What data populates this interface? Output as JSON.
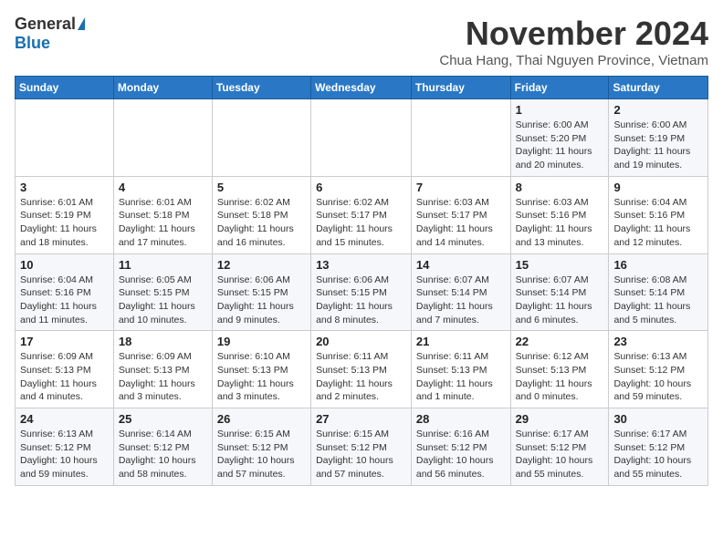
{
  "logo": {
    "general": "General",
    "blue": "Blue"
  },
  "title": "November 2024",
  "location": "Chua Hang, Thai Nguyen Province, Vietnam",
  "headers": [
    "Sunday",
    "Monday",
    "Tuesday",
    "Wednesday",
    "Thursday",
    "Friday",
    "Saturday"
  ],
  "weeks": [
    [
      {
        "day": "",
        "info": ""
      },
      {
        "day": "",
        "info": ""
      },
      {
        "day": "",
        "info": ""
      },
      {
        "day": "",
        "info": ""
      },
      {
        "day": "",
        "info": ""
      },
      {
        "day": "1",
        "info": "Sunrise: 6:00 AM\nSunset: 5:20 PM\nDaylight: 11 hours and 20 minutes."
      },
      {
        "day": "2",
        "info": "Sunrise: 6:00 AM\nSunset: 5:19 PM\nDaylight: 11 hours and 19 minutes."
      }
    ],
    [
      {
        "day": "3",
        "info": "Sunrise: 6:01 AM\nSunset: 5:19 PM\nDaylight: 11 hours and 18 minutes."
      },
      {
        "day": "4",
        "info": "Sunrise: 6:01 AM\nSunset: 5:18 PM\nDaylight: 11 hours and 17 minutes."
      },
      {
        "day": "5",
        "info": "Sunrise: 6:02 AM\nSunset: 5:18 PM\nDaylight: 11 hours and 16 minutes."
      },
      {
        "day": "6",
        "info": "Sunrise: 6:02 AM\nSunset: 5:17 PM\nDaylight: 11 hours and 15 minutes."
      },
      {
        "day": "7",
        "info": "Sunrise: 6:03 AM\nSunset: 5:17 PM\nDaylight: 11 hours and 14 minutes."
      },
      {
        "day": "8",
        "info": "Sunrise: 6:03 AM\nSunset: 5:16 PM\nDaylight: 11 hours and 13 minutes."
      },
      {
        "day": "9",
        "info": "Sunrise: 6:04 AM\nSunset: 5:16 PM\nDaylight: 11 hours and 12 minutes."
      }
    ],
    [
      {
        "day": "10",
        "info": "Sunrise: 6:04 AM\nSunset: 5:16 PM\nDaylight: 11 hours and 11 minutes."
      },
      {
        "day": "11",
        "info": "Sunrise: 6:05 AM\nSunset: 5:15 PM\nDaylight: 11 hours and 10 minutes."
      },
      {
        "day": "12",
        "info": "Sunrise: 6:06 AM\nSunset: 5:15 PM\nDaylight: 11 hours and 9 minutes."
      },
      {
        "day": "13",
        "info": "Sunrise: 6:06 AM\nSunset: 5:15 PM\nDaylight: 11 hours and 8 minutes."
      },
      {
        "day": "14",
        "info": "Sunrise: 6:07 AM\nSunset: 5:14 PM\nDaylight: 11 hours and 7 minutes."
      },
      {
        "day": "15",
        "info": "Sunrise: 6:07 AM\nSunset: 5:14 PM\nDaylight: 11 hours and 6 minutes."
      },
      {
        "day": "16",
        "info": "Sunrise: 6:08 AM\nSunset: 5:14 PM\nDaylight: 11 hours and 5 minutes."
      }
    ],
    [
      {
        "day": "17",
        "info": "Sunrise: 6:09 AM\nSunset: 5:13 PM\nDaylight: 11 hours and 4 minutes."
      },
      {
        "day": "18",
        "info": "Sunrise: 6:09 AM\nSunset: 5:13 PM\nDaylight: 11 hours and 3 minutes."
      },
      {
        "day": "19",
        "info": "Sunrise: 6:10 AM\nSunset: 5:13 PM\nDaylight: 11 hours and 3 minutes."
      },
      {
        "day": "20",
        "info": "Sunrise: 6:11 AM\nSunset: 5:13 PM\nDaylight: 11 hours and 2 minutes."
      },
      {
        "day": "21",
        "info": "Sunrise: 6:11 AM\nSunset: 5:13 PM\nDaylight: 11 hours and 1 minute."
      },
      {
        "day": "22",
        "info": "Sunrise: 6:12 AM\nSunset: 5:13 PM\nDaylight: 11 hours and 0 minutes."
      },
      {
        "day": "23",
        "info": "Sunrise: 6:13 AM\nSunset: 5:12 PM\nDaylight: 10 hours and 59 minutes."
      }
    ],
    [
      {
        "day": "24",
        "info": "Sunrise: 6:13 AM\nSunset: 5:12 PM\nDaylight: 10 hours and 59 minutes."
      },
      {
        "day": "25",
        "info": "Sunrise: 6:14 AM\nSunset: 5:12 PM\nDaylight: 10 hours and 58 minutes."
      },
      {
        "day": "26",
        "info": "Sunrise: 6:15 AM\nSunset: 5:12 PM\nDaylight: 10 hours and 57 minutes."
      },
      {
        "day": "27",
        "info": "Sunrise: 6:15 AM\nSunset: 5:12 PM\nDaylight: 10 hours and 57 minutes."
      },
      {
        "day": "28",
        "info": "Sunrise: 6:16 AM\nSunset: 5:12 PM\nDaylight: 10 hours and 56 minutes."
      },
      {
        "day": "29",
        "info": "Sunrise: 6:17 AM\nSunset: 5:12 PM\nDaylight: 10 hours and 55 minutes."
      },
      {
        "day": "30",
        "info": "Sunrise: 6:17 AM\nSunset: 5:12 PM\nDaylight: 10 hours and 55 minutes."
      }
    ]
  ]
}
